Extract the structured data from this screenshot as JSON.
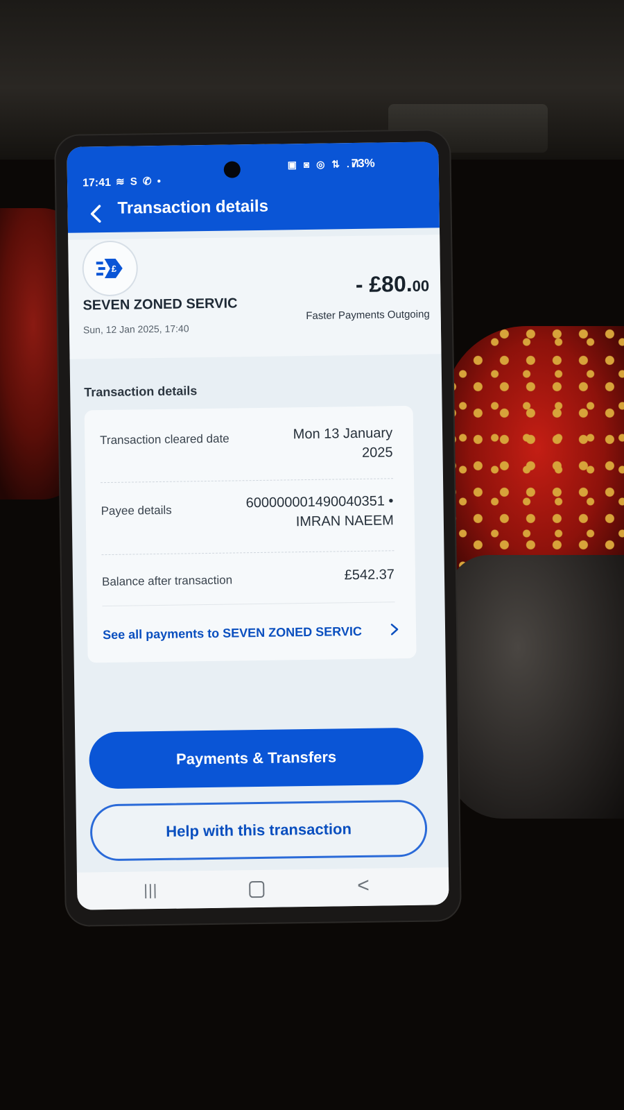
{
  "status_bar": {
    "time": "17:41",
    "left_icons": "≋ S ✆ •",
    "right_icons": "▣ ◙ ◎ ⇅ .ıl",
    "battery": "73%"
  },
  "header": {
    "title": "Transaction details",
    "back_icon": "chevron-left-icon"
  },
  "transaction": {
    "merchant": "SEVEN ZONED SERVIC",
    "datetime": "Sun, 12 Jan 2025, 17:40",
    "amount_main": "- £80.",
    "amount_pence": "00",
    "type": "Faster Payments Outgoing",
    "logo_icon": "fast-payment-icon"
  },
  "details": {
    "heading": "Transaction details",
    "rows": [
      {
        "label": "Transaction cleared date",
        "value_line1": "Mon 13 January",
        "value_line2": "2025"
      },
      {
        "label": "Payee details",
        "value_line1": "600000001490040351 •",
        "value_line2": "IMRAN NAEEM"
      },
      {
        "label": "Balance after transaction",
        "value_line1": "£542.37"
      }
    ],
    "see_all_link": "See all payments to SEVEN ZONED SERVIC"
  },
  "actions": {
    "primary": "Payments & Transfers",
    "secondary": "Help with this transaction"
  },
  "nav": {
    "recents": "|||",
    "back": "<"
  },
  "colors": {
    "brand_blue": "#0a55d6",
    "screen_bg": "#e8eff4"
  }
}
